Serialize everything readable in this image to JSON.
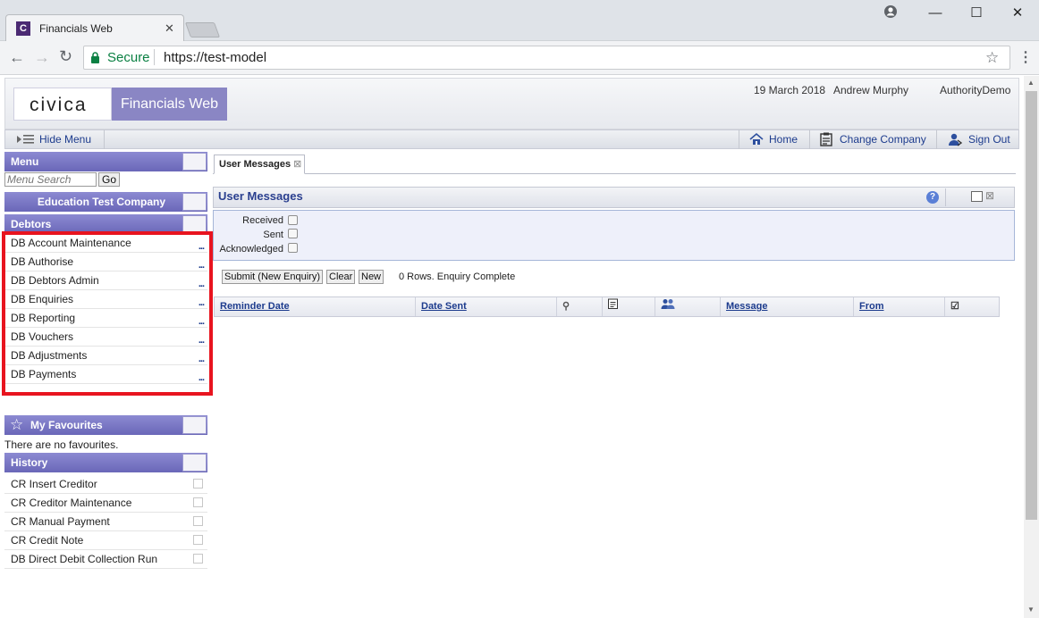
{
  "browser": {
    "tab_title": "Financials Web",
    "secure_label": "Secure",
    "url": "https://test-model",
    "favicon_letter": "C"
  },
  "header": {
    "logo_text": "civica",
    "app_name": "Financials Web",
    "date": "19 March 2018",
    "user": "Andrew Murphy",
    "authority": "AuthorityDemo"
  },
  "menubar": {
    "hide_menu": "Hide Menu",
    "home": "Home",
    "change_company": "Change Company",
    "sign_out": "Sign Out"
  },
  "menu": {
    "title": "Menu",
    "search_placeholder": "Menu Search",
    "go": "Go",
    "company": "Education Test Company",
    "section": "Debtors",
    "items": [
      "DB Account Maintenance",
      "DB Authorise",
      "DB Debtors Admin",
      "DB Enquiries",
      "DB Reporting",
      "DB Vouchers",
      "DB Adjustments",
      "DB Payments"
    ],
    "more": "..."
  },
  "favourites": {
    "title": "My Favourites",
    "empty_text": "There are no favourites."
  },
  "history": {
    "title": "History",
    "items": [
      "CR Insert Creditor",
      "CR Creditor Maintenance",
      "CR Manual Payment",
      "CR Credit Note",
      "DB Direct Debit Collection Run"
    ]
  },
  "content": {
    "tab_label": "User Messages",
    "panel_title": "User Messages",
    "filters": {
      "received": "Received",
      "sent": "Sent",
      "acknowledged": "Acknowledged"
    },
    "submit_label": "Submit (New Enquiry)",
    "clear_label": "Clear",
    "new_label": "New",
    "status_text": "0 Rows. Enquiry Complete",
    "columns": {
      "reminder_date": "Reminder Date",
      "date_sent": "Date Sent",
      "message": "Message",
      "from": "From"
    }
  },
  "colors": {
    "highlight": "#e8141f",
    "panel_header": "#6a67b8",
    "link": "#1c3b8d"
  }
}
